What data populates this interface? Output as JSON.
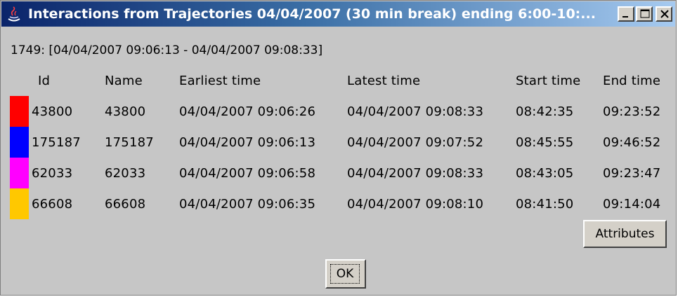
{
  "window": {
    "title": "Interactions from Trajectories 04/04/2007 (30 min break) ending 6:00-10:..."
  },
  "subtitle": "1749: [04/04/2007 09:06:13 - 04/04/2007 09:08:33]",
  "table": {
    "headers": {
      "id": "Id",
      "name": "Name",
      "earliest": "Earliest time",
      "latest": "Latest time",
      "start": "Start time",
      "end": "End time"
    },
    "rows": [
      {
        "color": "#ff0000",
        "id": "43800",
        "name": "43800",
        "earliest": "04/04/2007 09:06:26",
        "latest": "04/04/2007 09:08:33",
        "start": "08:42:35",
        "end": "09:23:52"
      },
      {
        "color": "#0000ff",
        "id": "175187",
        "name": "175187",
        "earliest": "04/04/2007 09:06:13",
        "latest": "04/04/2007 09:07:52",
        "start": "08:45:55",
        "end": "09:46:52"
      },
      {
        "color": "#ff00ff",
        "id": "62033",
        "name": "62033",
        "earliest": "04/04/2007 09:06:58",
        "latest": "04/04/2007 09:08:33",
        "start": "08:43:05",
        "end": "09:23:47"
      },
      {
        "color": "#ffc800",
        "id": "66608",
        "name": "66608",
        "earliest": "04/04/2007 09:06:35",
        "latest": "04/04/2007 09:08:10",
        "start": "08:41:50",
        "end": "09:14:04"
      }
    ]
  },
  "buttons": {
    "attributes": "Attributes",
    "ok": "OK"
  }
}
